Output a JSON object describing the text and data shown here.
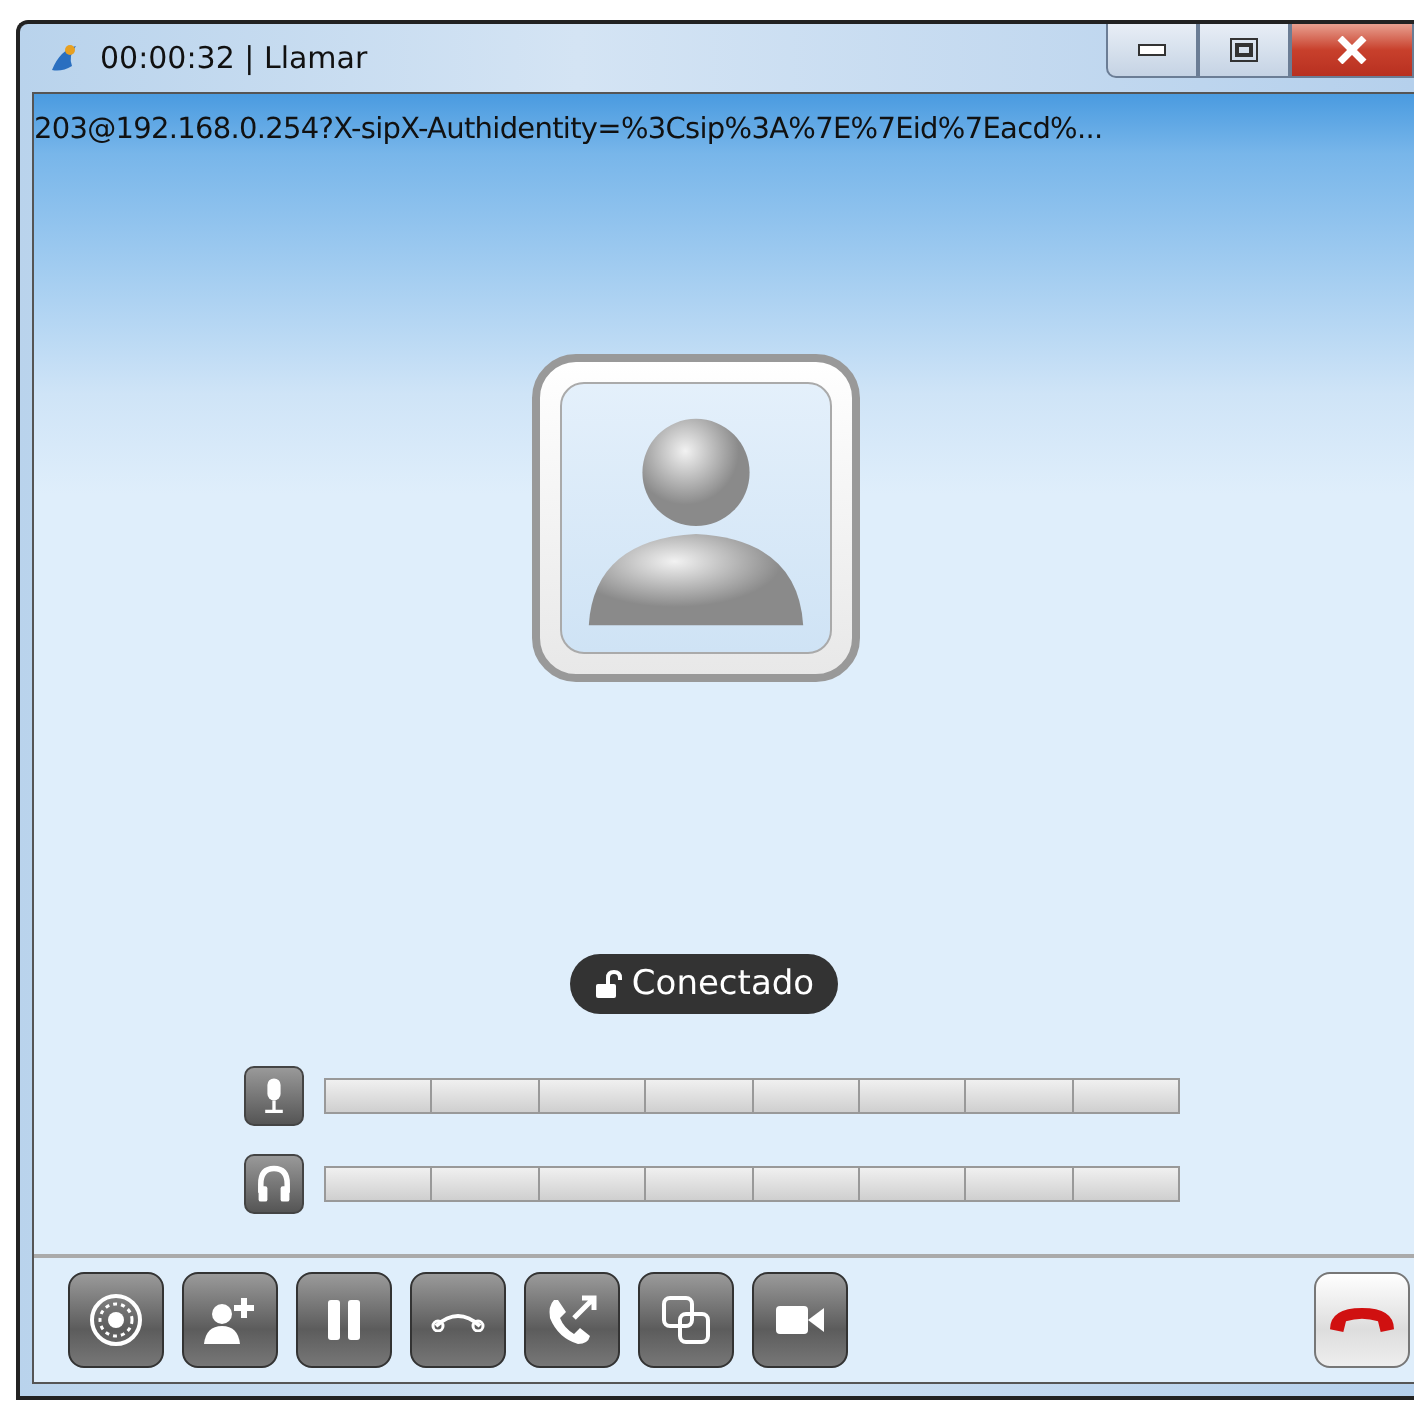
{
  "window": {
    "title": "00:00:32 | Llamar"
  },
  "address": "203@192.168.0.254?X-sipX-Authidentity=%3Csip%3A%7E%7Eid%7Eacd%...",
  "status": {
    "label": "Conectado",
    "secure": false
  },
  "meters": [
    {
      "kind": "microphone"
    },
    {
      "kind": "speaker"
    }
  ],
  "toolbar": [
    {
      "kind": "dialpad"
    },
    {
      "kind": "add-contact"
    },
    {
      "kind": "hold"
    },
    {
      "kind": "mute"
    },
    {
      "kind": "transfer"
    },
    {
      "kind": "conference"
    },
    {
      "kind": "video"
    }
  ],
  "hangup": {
    "kind": "hangup"
  }
}
